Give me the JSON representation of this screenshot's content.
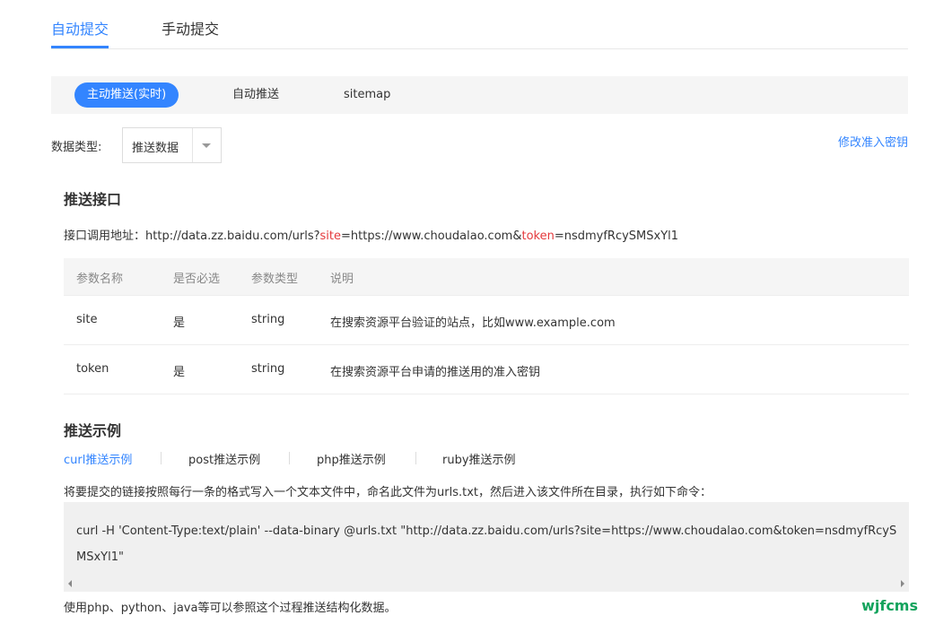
{
  "top_tabs": [
    {
      "label": "自动提交",
      "active": true
    },
    {
      "label": "手动提交",
      "active": false
    }
  ],
  "sub_tabs": [
    {
      "label": "主动推送(实时)",
      "active": true
    },
    {
      "label": "自动推送",
      "active": false
    },
    {
      "label": "sitemap",
      "active": false
    }
  ],
  "data_type": {
    "label": "数据类型:",
    "selected": "推送数据"
  },
  "modify_key_link": "修改准入密钥",
  "push_api": {
    "title": "推送接口",
    "label": "接口调用地址：",
    "url_part1": "http://data.zz.baidu.com/urls?",
    "param1": "site",
    "url_part2": "=https://www.choudalao.com&",
    "param2": "token",
    "url_part3": "=nsdmyfRcySMSxYl1"
  },
  "params_table": {
    "headers": [
      "参数名称",
      "是否必选",
      "参数类型",
      "说明"
    ],
    "rows": [
      [
        "site",
        "是",
        "string",
        "在搜索资源平台验证的站点，比如www.example.com"
      ],
      [
        "token",
        "是",
        "string",
        "在搜索资源平台申请的推送用的准入密钥"
      ]
    ]
  },
  "push_example": {
    "title": "推送示例",
    "tabs": [
      {
        "label": "curl推送示例",
        "active": true
      },
      {
        "label": "post推送示例",
        "active": false
      },
      {
        "label": "php推送示例",
        "active": false
      },
      {
        "label": "ruby推送示例",
        "active": false
      }
    ],
    "description": "将要提交的链接按照每行一条的格式写入一个文本文件中，命名此文件为urls.txt，然后进入该文件所在目录，执行如下命令：",
    "code": "curl -H 'Content-Type:text/plain' --data-binary @urls.txt \"http://data.zz.baidu.com/urls?site=https://www.choudalao.com&token=nsdmyfRcySMSxYl1\"",
    "footer": "使用php、python、java等可以参照这个过程推送结构化数据。"
  },
  "watermark": "wjfcms",
  "colors": {
    "accent": "#3385ff",
    "param_red": "#e4393c",
    "watermark_green": "#12a35c"
  }
}
